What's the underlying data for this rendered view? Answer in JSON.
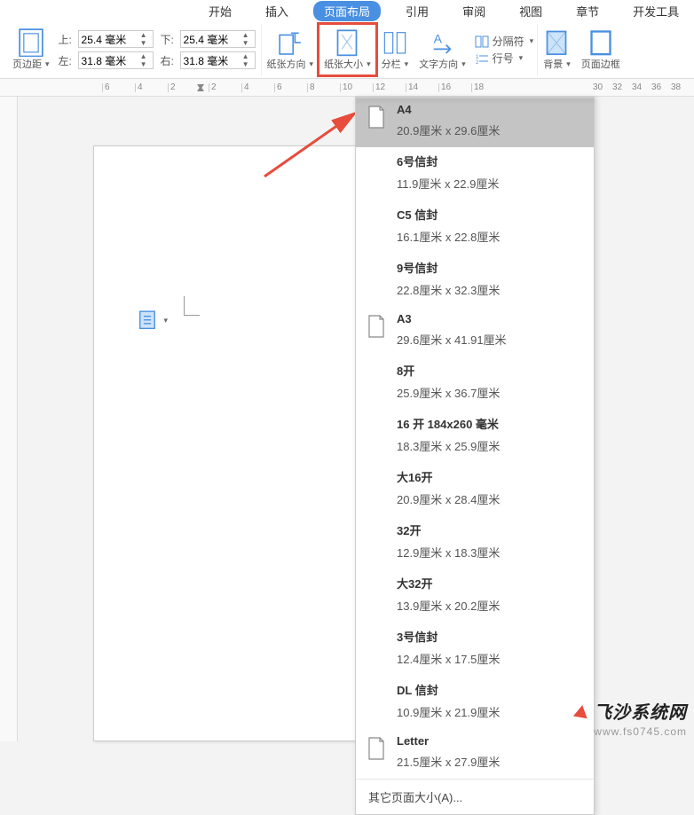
{
  "tabs": {
    "items": [
      {
        "label": "开始"
      },
      {
        "label": "插入"
      },
      {
        "label": "页面布局",
        "active": true
      },
      {
        "label": "引用"
      },
      {
        "label": "审阅"
      },
      {
        "label": "视图"
      },
      {
        "label": "章节"
      },
      {
        "label": "开发工具"
      }
    ]
  },
  "ribbon": {
    "margins_label": "页边距",
    "margins": {
      "top_lbl": "上:",
      "top_val": "25.4 毫米",
      "bottom_lbl": "下:",
      "bottom_val": "25.4 毫米",
      "left_lbl": "左:",
      "left_val": "31.8 毫米",
      "right_lbl": "右:",
      "right_val": "31.8 毫米"
    },
    "orientation_label": "纸张方向",
    "size_label": "纸张大小",
    "columns_label": "分栏",
    "text_dir_label": "文字方向",
    "separator_label": "分隔符",
    "line_num_label": "行号",
    "background_label": "背景",
    "page_border_label": "页面边框"
  },
  "ruler": {
    "left_nums": [
      "6",
      "4",
      "2"
    ],
    "right_nums": [
      "2",
      "4",
      "6",
      "8",
      "10",
      "12",
      "14",
      "16",
      "18"
    ],
    "far_nums": [
      "30",
      "32",
      "34",
      "36",
      "38"
    ]
  },
  "paper_sizes": [
    {
      "name": "A4",
      "dim": "20.9厘米  x  29.6厘米",
      "sel": true,
      "icon": true
    },
    {
      "name": "6号信封",
      "dim": "11.9厘米  x  22.9厘米"
    },
    {
      "name": "C5 信封",
      "dim": "16.1厘米  x  22.8厘米"
    },
    {
      "name": "9号信封",
      "dim": "22.8厘米  x  32.3厘米"
    },
    {
      "name": "A3",
      "dim": "29.6厘米  x  41.91厘米",
      "icon": true
    },
    {
      "name": "8开",
      "dim": "25.9厘米  x  36.7厘米"
    },
    {
      "name": "16 开 184x260 毫米",
      "dim": "18.3厘米  x  25.9厘米"
    },
    {
      "name": "大16开",
      "dim": "20.9厘米  x  28.4厘米"
    },
    {
      "name": "32开",
      "dim": "12.9厘米  x  18.3厘米"
    },
    {
      "name": "大32开",
      "dim": "13.9厘米  x  20.2厘米"
    },
    {
      "name": "3号信封",
      "dim": "12.4厘米  x  17.5厘米"
    },
    {
      "name": "DL 信封",
      "dim": "10.9厘米  x  21.9厘米"
    },
    {
      "name": "Letter",
      "dim": "21.5厘米  x  27.9厘米",
      "icon": true
    }
  ],
  "paper_footer": "其它页面大小(A)...",
  "watermark": {
    "brand": "飞沙系统网",
    "url": "www.fs0745.com"
  }
}
